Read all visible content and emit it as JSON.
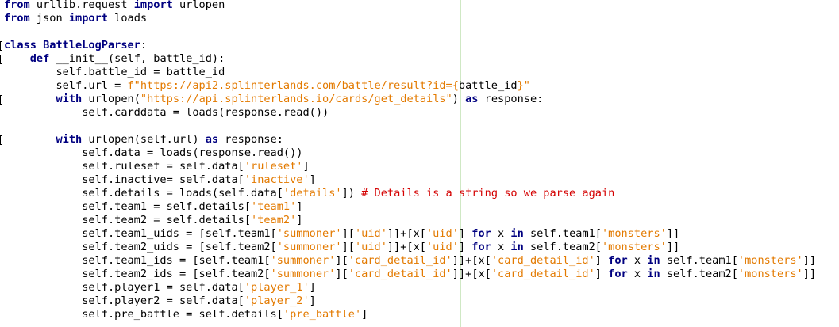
{
  "editor": {
    "language": "python",
    "colors": {
      "keyword": "#000080",
      "string": "#e37a00",
      "comment": "#d40000",
      "text": "#000000",
      "margin_guide": "#cfe8c4"
    },
    "lines": [
      [
        {
          "t": "kw",
          "v": "from"
        },
        {
          "t": "p",
          "v": " urllib.request "
        },
        {
          "t": "kw",
          "v": "import"
        },
        {
          "t": "p",
          "v": " urlopen"
        }
      ],
      [
        {
          "t": "kw",
          "v": "from"
        },
        {
          "t": "p",
          "v": " json "
        },
        {
          "t": "kw",
          "v": "import"
        },
        {
          "t": "p",
          "v": " loads"
        }
      ],
      [],
      [
        {
          "t": "kw",
          "v": "class"
        },
        {
          "t": "p",
          "v": " "
        },
        {
          "t": "kw",
          "v": "BattleLogParser"
        },
        {
          "t": "p",
          "v": ":"
        }
      ],
      [
        {
          "t": "p",
          "v": "    "
        },
        {
          "t": "kw",
          "v": "def"
        },
        {
          "t": "p",
          "v": " __init__(self, battle_id):"
        }
      ],
      [
        {
          "t": "p",
          "v": "        self.battle_id = battle_id"
        }
      ],
      [
        {
          "t": "p",
          "v": "        self.url = "
        },
        {
          "t": "str",
          "v": "f\"https://api2.splinterlands.com/battle/result?id={"
        },
        {
          "t": "p",
          "v": "battle_id"
        },
        {
          "t": "str",
          "v": "}\""
        }
      ],
      [
        {
          "t": "p",
          "v": "        "
        },
        {
          "t": "kw",
          "v": "with"
        },
        {
          "t": "p",
          "v": " urlopen("
        },
        {
          "t": "str",
          "v": "\"https://api.splinterlands.io/cards/get_details\""
        },
        {
          "t": "p",
          "v": ") "
        },
        {
          "t": "kw",
          "v": "as"
        },
        {
          "t": "p",
          "v": " response:"
        }
      ],
      [
        {
          "t": "p",
          "v": "            self.carddata = loads(response.read())"
        }
      ],
      [],
      [
        {
          "t": "p",
          "v": "        "
        },
        {
          "t": "kw",
          "v": "with"
        },
        {
          "t": "p",
          "v": " urlopen(self.url) "
        },
        {
          "t": "kw",
          "v": "as"
        },
        {
          "t": "p",
          "v": " response:"
        }
      ],
      [
        {
          "t": "p",
          "v": "            self.data = loads(response.read())"
        }
      ],
      [
        {
          "t": "p",
          "v": "            self.ruleset = self.data["
        },
        {
          "t": "str",
          "v": "'ruleset'"
        },
        {
          "t": "p",
          "v": "]"
        }
      ],
      [
        {
          "t": "p",
          "v": "            self.inactive= self.data["
        },
        {
          "t": "str",
          "v": "'inactive'"
        },
        {
          "t": "p",
          "v": "]"
        }
      ],
      [
        {
          "t": "p",
          "v": "            self.details = loads(self.data["
        },
        {
          "t": "str",
          "v": "'details'"
        },
        {
          "t": "p",
          "v": "]) "
        },
        {
          "t": "cm",
          "v": "# Details is a string so we parse again"
        }
      ],
      [
        {
          "t": "p",
          "v": "            self.team1 = self.details["
        },
        {
          "t": "str",
          "v": "'team1'"
        },
        {
          "t": "p",
          "v": "]"
        }
      ],
      [
        {
          "t": "p",
          "v": "            self.team2 = self.details["
        },
        {
          "t": "str",
          "v": "'team2'"
        },
        {
          "t": "p",
          "v": "]"
        }
      ],
      [
        {
          "t": "p",
          "v": "            self.team1_uids = [self.team1["
        },
        {
          "t": "str",
          "v": "'summoner'"
        },
        {
          "t": "p",
          "v": "]["
        },
        {
          "t": "str",
          "v": "'uid'"
        },
        {
          "t": "p",
          "v": "]]+[x["
        },
        {
          "t": "str",
          "v": "'uid'"
        },
        {
          "t": "p",
          "v": "] "
        },
        {
          "t": "kw",
          "v": "for"
        },
        {
          "t": "p",
          "v": " x "
        },
        {
          "t": "kw",
          "v": "in"
        },
        {
          "t": "p",
          "v": " self.team1["
        },
        {
          "t": "str",
          "v": "'monsters'"
        },
        {
          "t": "p",
          "v": "]]"
        }
      ],
      [
        {
          "t": "p",
          "v": "            self.team2_uids = [self.team2["
        },
        {
          "t": "str",
          "v": "'summoner'"
        },
        {
          "t": "p",
          "v": "]["
        },
        {
          "t": "str",
          "v": "'uid'"
        },
        {
          "t": "p",
          "v": "]]+[x["
        },
        {
          "t": "str",
          "v": "'uid'"
        },
        {
          "t": "p",
          "v": "] "
        },
        {
          "t": "kw",
          "v": "for"
        },
        {
          "t": "p",
          "v": " x "
        },
        {
          "t": "kw",
          "v": "in"
        },
        {
          "t": "p",
          "v": " self.team2["
        },
        {
          "t": "str",
          "v": "'monsters'"
        },
        {
          "t": "p",
          "v": "]]"
        }
      ],
      [
        {
          "t": "p",
          "v": "            self.team1_ids = [self.team1["
        },
        {
          "t": "str",
          "v": "'summoner'"
        },
        {
          "t": "p",
          "v": "]["
        },
        {
          "t": "str",
          "v": "'card_detail_id'"
        },
        {
          "t": "p",
          "v": "]]+[x["
        },
        {
          "t": "str",
          "v": "'card_detail_id'"
        },
        {
          "t": "p",
          "v": "] "
        },
        {
          "t": "kw",
          "v": "for"
        },
        {
          "t": "p",
          "v": " x "
        },
        {
          "t": "kw",
          "v": "in"
        },
        {
          "t": "p",
          "v": " self.team1["
        },
        {
          "t": "str",
          "v": "'monsters'"
        },
        {
          "t": "p",
          "v": "]]"
        }
      ],
      [
        {
          "t": "p",
          "v": "            self.team2_ids = [self.team2["
        },
        {
          "t": "str",
          "v": "'summoner'"
        },
        {
          "t": "p",
          "v": "]["
        },
        {
          "t": "str",
          "v": "'card_detail_id'"
        },
        {
          "t": "p",
          "v": "]]+[x["
        },
        {
          "t": "str",
          "v": "'card_detail_id'"
        },
        {
          "t": "p",
          "v": "] "
        },
        {
          "t": "kw",
          "v": "for"
        },
        {
          "t": "p",
          "v": " x "
        },
        {
          "t": "kw",
          "v": "in"
        },
        {
          "t": "p",
          "v": " self.team2["
        },
        {
          "t": "str",
          "v": "'monsters'"
        },
        {
          "t": "p",
          "v": "]]"
        }
      ],
      [
        {
          "t": "p",
          "v": "            self.player1 = self.data["
        },
        {
          "t": "str",
          "v": "'player_1'"
        },
        {
          "t": "p",
          "v": "]"
        }
      ],
      [
        {
          "t": "p",
          "v": "            self.player2 = self.data["
        },
        {
          "t": "str",
          "v": "'player_2'"
        },
        {
          "t": "p",
          "v": "]"
        }
      ],
      [
        {
          "t": "p",
          "v": "            self.pre_battle = self.details["
        },
        {
          "t": "str",
          "v": "'pre_battle'"
        },
        {
          "t": "p",
          "v": "]"
        }
      ]
    ],
    "fold_markers_on_lines": [
      3,
      4,
      7,
      10
    ]
  }
}
